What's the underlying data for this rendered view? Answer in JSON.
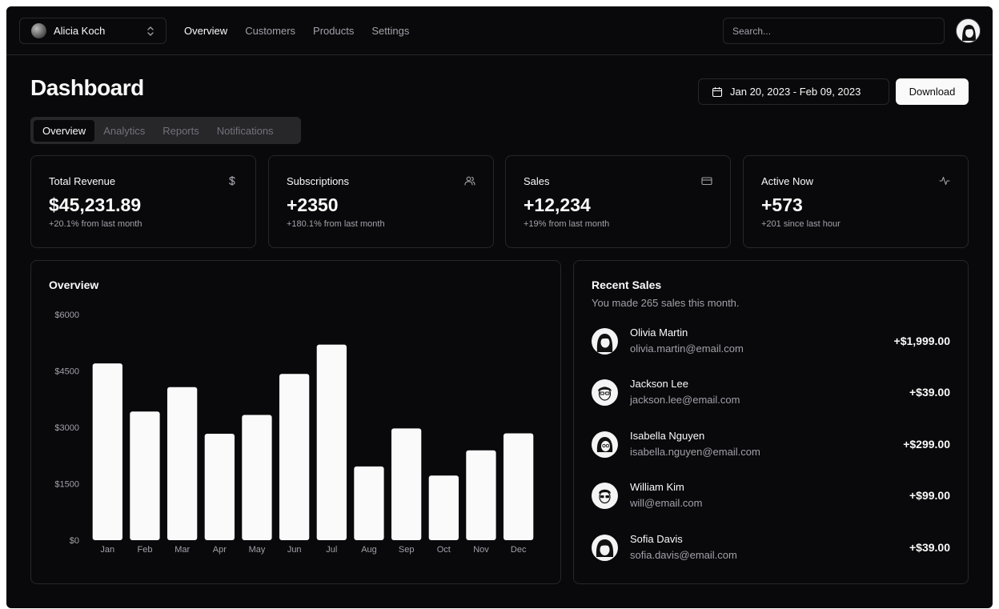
{
  "topbar": {
    "team": "Alicia Koch",
    "nav": [
      "Overview",
      "Customers",
      "Products",
      "Settings"
    ],
    "search_placeholder": "Search..."
  },
  "header": {
    "title": "Dashboard",
    "date_range": "Jan 20, 2023 - Feb 09, 2023",
    "download_label": "Download"
  },
  "tabs": [
    "Overview",
    "Analytics",
    "Reports",
    "Notifications"
  ],
  "stats": [
    {
      "title": "Total Revenue",
      "value": "$45,231.89",
      "sub": "+20.1% from last month",
      "icon": "dollar-icon"
    },
    {
      "title": "Subscriptions",
      "value": "+2350",
      "sub": "+180.1% from last month",
      "icon": "users-icon"
    },
    {
      "title": "Sales",
      "value": "+12,234",
      "sub": "+19% from last month",
      "icon": "credit-card-icon"
    },
    {
      "title": "Active Now",
      "value": "+573",
      "sub": "+201 since last hour",
      "icon": "activity-icon"
    }
  ],
  "overview": {
    "title": "Overview"
  },
  "chart_data": {
    "type": "bar",
    "categories": [
      "Jan",
      "Feb",
      "Mar",
      "Apr",
      "May",
      "Jun",
      "Jul",
      "Aug",
      "Sep",
      "Oct",
      "Nov",
      "Dec"
    ],
    "values": [
      4700,
      3420,
      4070,
      2830,
      3330,
      4420,
      5200,
      1960,
      2970,
      1720,
      2390,
      2840
    ],
    "y_ticks": [
      "$0",
      "$1500",
      "$3000",
      "$4500",
      "$6000"
    ],
    "ylim": [
      0,
      6000
    ],
    "bar_color": "#fafafa",
    "grid": false
  },
  "recent_sales": {
    "title": "Recent Sales",
    "subtitle": "You made 265 sales this month.",
    "items": [
      {
        "name": "Olivia Martin",
        "email": "olivia.martin@email.com",
        "amount": "+$1,999.00"
      },
      {
        "name": "Jackson Lee",
        "email": "jackson.lee@email.com",
        "amount": "+$39.00"
      },
      {
        "name": "Isabella Nguyen",
        "email": "isabella.nguyen@email.com",
        "amount": "+$299.00"
      },
      {
        "name": "William Kim",
        "email": "will@email.com",
        "amount": "+$99.00"
      },
      {
        "name": "Sofia Davis",
        "email": "sofia.davis@email.com",
        "amount": "+$39.00"
      }
    ]
  },
  "colors": {
    "background": "#09090b",
    "border": "#27272a",
    "foreground": "#fafafa",
    "muted": "#a1a1aa"
  }
}
